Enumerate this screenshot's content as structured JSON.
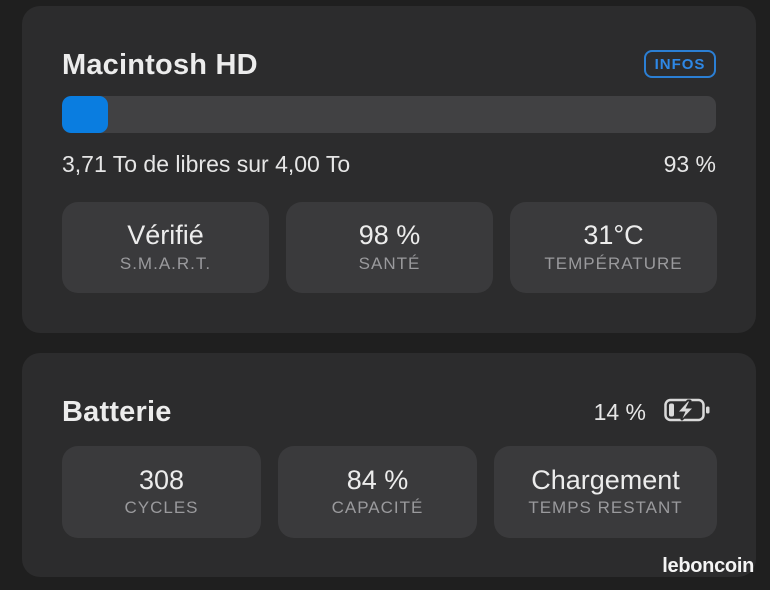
{
  "disk": {
    "title": "Macintosh HD",
    "info_button": "INFOS",
    "used_fraction": 0.07,
    "usage_text": "3,71 To de libres sur 4,00 To",
    "free_percent": "93 %",
    "fill_color": "#0a7de0",
    "tiles": [
      {
        "value": "Vérifié",
        "label": "S.M.A.R.T."
      },
      {
        "value": "98 %",
        "label": "SANTÉ"
      },
      {
        "value": "31°C",
        "label": "TEMPÉRATURE"
      }
    ]
  },
  "battery": {
    "title": "Batterie",
    "percent": "14 %",
    "icon": "battery-charging-icon",
    "tiles": [
      {
        "value": "308",
        "label": "CYCLES"
      },
      {
        "value": "84 %",
        "label": "CAPACITÉ"
      },
      {
        "value": "Chargement",
        "label": "TEMPS RESTANT"
      }
    ]
  },
  "watermark": "leboncoin"
}
